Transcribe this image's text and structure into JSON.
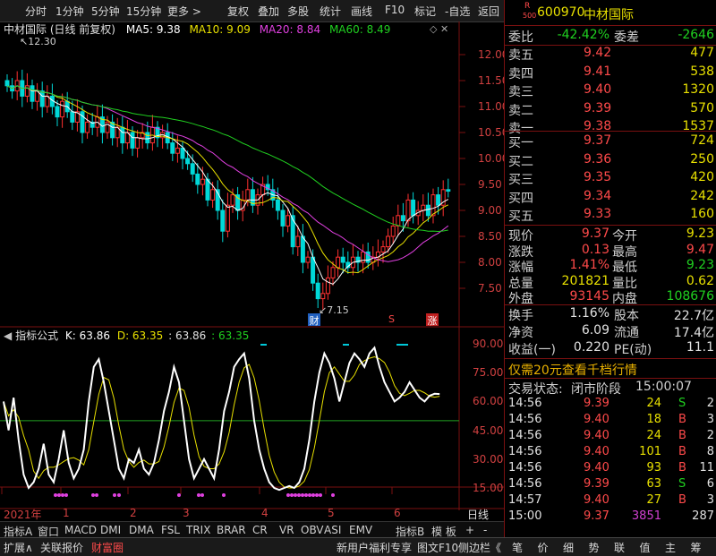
{
  "toolbar": {
    "items": [
      "分时",
      "1分钟",
      "5分钟",
      "15分钟",
      "更多 >",
      "复权",
      "叠加",
      "多股",
      "统计",
      "画线",
      "F10",
      "标记",
      "-自选",
      "返回"
    ]
  },
  "chart": {
    "title": "中材国际 (日线 前复权)",
    "ma5": "MA5: 9.38",
    "ma10": "MA10: 9.09",
    "ma20": "MA20: 8.84",
    "ma60": "MA60: 8.49",
    "high_label": "12.30",
    "low_label": "7.15",
    "price_ticks": [
      "12.00",
      "11.50",
      "11.00",
      "10.50",
      "10.00",
      "9.50",
      "9.00",
      "8.50",
      "8.00",
      "7.50"
    ],
    "markers": [
      "财",
      "S",
      "涨"
    ],
    "indicator_title": "指标公式",
    "ind_k": "K: 63.86",
    "ind_d": "D: 63.35",
    "ind_j": ": 63.86",
    "ind_v": ": 63.35",
    "ind_ticks": [
      "90.00",
      "75.00",
      "60.00",
      "45.00",
      "30.00",
      "15.00"
    ],
    "date_labels": [
      "2021年",
      "1",
      "2",
      "3",
      "4",
      "5",
      "6"
    ],
    "period": "日线",
    "tabs": [
      "指标A",
      "窗口",
      "MACD",
      "DMI",
      "DMA",
      "FSL",
      "TRIX",
      "BRAR",
      "CR",
      "VR",
      "OBV",
      "ASI",
      "EMV",
      "指标B",
      "模 板",
      "+",
      "-"
    ],
    "colors": {
      "ma5": "#ffffff",
      "ma10": "#e8e000",
      "ma20": "#e040e0",
      "ma60": "#20d020",
      "up": "#ff3030",
      "down": "#00d8d8"
    }
  },
  "quote": {
    "code": "600970",
    "name": "中材国际",
    "code_prefix": "R",
    "code_sub": "500",
    "weibi_label": "委比",
    "weibi": "-42.42%",
    "weicha_label": "委差",
    "weicha": "-2646",
    "asks": [
      {
        "label": "卖五",
        "price": "9.42",
        "vol": "477"
      },
      {
        "label": "卖四",
        "price": "9.41",
        "vol": "538"
      },
      {
        "label": "卖三",
        "price": "9.40",
        "vol": "1320"
      },
      {
        "label": "卖二",
        "price": "9.39",
        "vol": "570"
      },
      {
        "label": "卖一",
        "price": "9.38",
        "vol": "1537"
      }
    ],
    "bids": [
      {
        "label": "买一",
        "price": "9.37",
        "vol": "724"
      },
      {
        "label": "买二",
        "price": "9.36",
        "vol": "250"
      },
      {
        "label": "买三",
        "price": "9.35",
        "vol": "420"
      },
      {
        "label": "买四",
        "price": "9.34",
        "vol": "242"
      },
      {
        "label": "买五",
        "price": "9.33",
        "vol": "160"
      }
    ],
    "stats": [
      {
        "l1": "现价",
        "v1": "9.37",
        "l2": "今开",
        "v2": "9.23"
      },
      {
        "l1": "涨跌",
        "v1": "0.13",
        "l2": "最高",
        "v2": "9.47"
      },
      {
        "l1": "涨幅",
        "v1": "1.41%",
        "l2": "最低",
        "v2": "9.23"
      },
      {
        "l1": "总量",
        "v1": "201821",
        "l2": "量比",
        "v2": "0.62"
      },
      {
        "l1": "外盘",
        "v1": "93145",
        "l2": "内盘",
        "v2": "108676"
      }
    ],
    "stats2": [
      {
        "l1": "换手",
        "v1": "1.16%",
        "l2": "股本",
        "v2": "22.7亿"
      },
      {
        "l1": "净资",
        "v1": "6.09",
        "l2": "流通",
        "v2": "17.4亿"
      },
      {
        "l1": "收益(一)",
        "v1": "0.220",
        "l2": "PE(动)",
        "v2": "11.1"
      }
    ],
    "promo": "仅需20元查看千档行情",
    "status_label": "交易状态:",
    "status": "闭市阶段",
    "status_time": "15:00:07",
    "ticks": [
      {
        "t": "14:56",
        "p": "9.39",
        "v": "24",
        "s": "S",
        "n": "2"
      },
      {
        "t": "14:56",
        "p": "9.40",
        "v": "18",
        "s": "B",
        "n": "3"
      },
      {
        "t": "14:56",
        "p": "9.40",
        "v": "24",
        "s": "B",
        "n": "2"
      },
      {
        "t": "14:56",
        "p": "9.40",
        "v": "101",
        "s": "B",
        "n": "8"
      },
      {
        "t": "14:56",
        "p": "9.40",
        "v": "93",
        "s": "B",
        "n": "11"
      },
      {
        "t": "14:56",
        "p": "9.39",
        "v": "63",
        "s": "S",
        "n": "6"
      },
      {
        "t": "14:57",
        "p": "9.40",
        "v": "27",
        "s": "B",
        "n": "3"
      },
      {
        "t": "15:00",
        "p": "9.37",
        "v": "3851",
        "s": "",
        "n": "287"
      }
    ]
  },
  "bottombar": {
    "items": [
      "扩展∧",
      "关联报价",
      "财富圈",
      "新用户福利专享",
      "图文F10",
      "侧边栏《"
    ],
    "right_items": [
      "笔",
      "价",
      "细",
      "势",
      "联",
      "值",
      "主",
      "筹"
    ]
  }
}
